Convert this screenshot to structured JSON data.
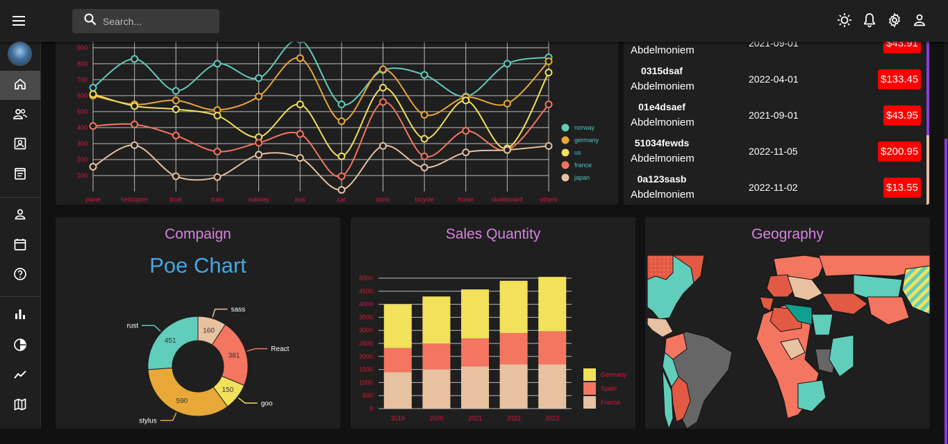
{
  "search": {
    "placeholder": "Search..."
  },
  "colors": {
    "accent": "#d783e0",
    "negative": "#ff0000",
    "link_blue": "#41a8e8"
  },
  "icons": {
    "menu": "menu-icon",
    "search": "search-icon",
    "theme": "light-mode-icon",
    "notifications": "bell-icon",
    "settings": "gear-icon",
    "profile": "person-icon"
  },
  "sidebar": {
    "items": [
      {
        "name": "home",
        "icon": "home-icon",
        "active": true
      },
      {
        "name": "team",
        "icon": "people-icon"
      },
      {
        "name": "contacts",
        "icon": "contacts-icon"
      },
      {
        "name": "invoices",
        "icon": "receipt-icon"
      },
      {
        "name": "profile-form",
        "icon": "person-outline-icon"
      },
      {
        "name": "calendar",
        "icon": "calendar-icon"
      },
      {
        "name": "faq",
        "icon": "help-icon"
      },
      {
        "name": "bar-chart",
        "icon": "bar-chart-icon"
      },
      {
        "name": "pie-chart",
        "icon": "pie-chart-icon"
      },
      {
        "name": "line-chart",
        "icon": "line-chart-icon"
      },
      {
        "name": "geography",
        "icon": "map-icon"
      }
    ]
  },
  "transactions": [
    {
      "id": "",
      "user": "Abdelmoniem",
      "date": "2021-09-01",
      "cost": "$43.91"
    },
    {
      "id": "0315dsaf",
      "user": "Abdelmoniem",
      "date": "2022-04-01",
      "cost": "$133.45"
    },
    {
      "id": "01e4dsaef",
      "user": "Abdelmoniem",
      "date": "2021-09-01",
      "cost": "$43.95"
    },
    {
      "id": "51034fewds",
      "user": "Abdelmoniem",
      "date": "2022-11-05",
      "cost": "$200.95"
    },
    {
      "id": "0a123sasb",
      "user": "Abdelmoniem",
      "date": "2022-11-02",
      "cost": "$13.55"
    }
  ],
  "campaign": {
    "title": "Compaign",
    "subtitle": "Poe Chart"
  },
  "sales": {
    "title": "Sales Quantity"
  },
  "geography": {
    "title": "Geography"
  },
  "chart_data": [
    {
      "type": "line",
      "categories": [
        "plane",
        "helicopter",
        "boat",
        "train",
        "subway",
        "bus",
        "car",
        "moto",
        "bicycle",
        "horse",
        "skateboard",
        "others"
      ],
      "ylim": [
        0,
        960
      ],
      "yticks": [
        100,
        200,
        300,
        400,
        500,
        600,
        700,
        800,
        900
      ],
      "legend": "right",
      "grid": true,
      "series": [
        {
          "name": "norway",
          "color": "#61cdbb",
          "values": [
            650,
            830,
            630,
            800,
            710,
            950,
            545,
            760,
            730,
            595,
            800,
            840
          ]
        },
        {
          "name": "germany",
          "color": "#e8a838",
          "values": [
            600,
            545,
            570,
            510,
            595,
            835,
            440,
            765,
            480,
            590,
            550,
            815
          ]
        },
        {
          "name": "us",
          "color": "#f1e15b",
          "values": [
            610,
            535,
            515,
            475,
            340,
            545,
            220,
            650,
            330,
            570,
            270,
            745
          ]
        },
        {
          "name": "france",
          "color": "#f47560",
          "values": [
            410,
            420,
            350,
            250,
            305,
            360,
            95,
            560,
            220,
            380,
            260,
            545
          ]
        },
        {
          "name": "japan",
          "color": "#e8c1a0",
          "values": [
            155,
            290,
            95,
            90,
            230,
            210,
            10,
            285,
            150,
            245,
            260,
            285
          ]
        }
      ]
    },
    {
      "type": "pie",
      "slices": [
        {
          "label": "sass",
          "value": 160,
          "color": "#e8c1a0"
        },
        {
          "label": "React",
          "value": 381,
          "color": "#f47560"
        },
        {
          "label": "goo",
          "value": 150,
          "color": "#f1e15b"
        },
        {
          "label": "stylus",
          "value": 590,
          "color": "#e8a838"
        },
        {
          "label": "rust",
          "value": 451,
          "color": "#61cdbb"
        }
      ]
    },
    {
      "type": "bar",
      "stacked": true,
      "categories": [
        "2019",
        "2020",
        "2021",
        "2022",
        "2023"
      ],
      "ylim": [
        0,
        5000
      ],
      "yticks": [
        0,
        500,
        1000,
        1500,
        2000,
        2500,
        3000,
        3500,
        4000,
        4500,
        5000
      ],
      "legend": "right",
      "series": [
        {
          "name": "France",
          "color": "#e8c1a0",
          "values": [
            1400,
            1500,
            1620,
            1700,
            1700
          ]
        },
        {
          "name": "Spain",
          "color": "#f47560",
          "values": [
            920,
            1000,
            1070,
            1200,
            1260
          ]
        },
        {
          "name": "Germany",
          "color": "#f1e15b",
          "values": [
            1680,
            1800,
            1880,
            2000,
            2090
          ]
        }
      ],
      "legend_order": [
        "Germany",
        "Spain",
        "France"
      ]
    }
  ]
}
